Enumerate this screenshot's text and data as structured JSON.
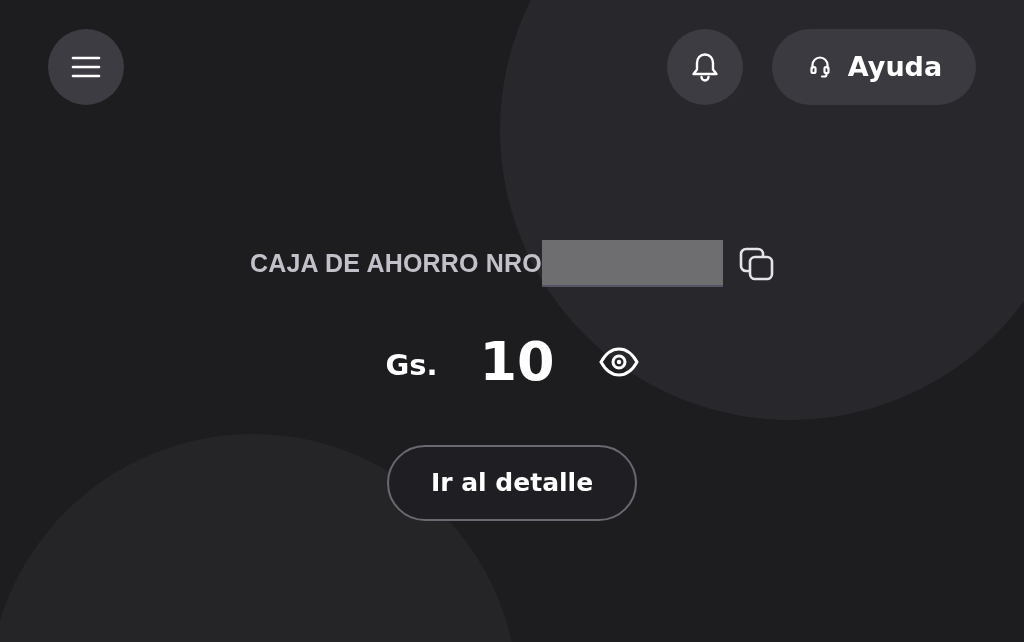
{
  "header": {
    "help_button": {
      "label": "Ayuda"
    }
  },
  "account": {
    "label": "CAJA DE AHORRO NRO"
  },
  "balance": {
    "currency": "Gs.",
    "amount": "10"
  },
  "detail_button": {
    "label": "Ir al detalle"
  }
}
